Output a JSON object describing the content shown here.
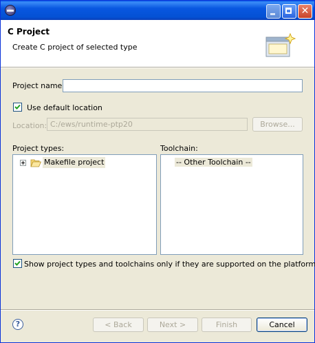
{
  "window": {
    "title": "",
    "controls": [
      "minimize-icon",
      "maximize-icon",
      "close-icon"
    ]
  },
  "header": {
    "title": "C Project",
    "description": "Create C project of selected type"
  },
  "form": {
    "project_name_label": "Project name:",
    "project_name_value": "",
    "use_default_location_label": "Use default location",
    "use_default_location_checked": true,
    "location_label": "Location:",
    "location_value": "C:/ews/runtime-ptp20",
    "browse_label": "Browse..."
  },
  "project_types": {
    "label": "Project types:",
    "items": [
      {
        "label": "Makefile project",
        "icon": "folder-open-icon",
        "expandable": true,
        "selected": true
      }
    ]
  },
  "toolchain": {
    "label": "Toolchain:",
    "items": [
      {
        "label": "-- Other Toolchain --",
        "selected": true
      }
    ]
  },
  "filter": {
    "label": "Show project types and toolchains only if they are supported on the platform",
    "checked": true
  },
  "buttons": {
    "back": "< Back",
    "next": "Next >",
    "finish": "Finish",
    "cancel": "Cancel"
  },
  "colors": {
    "titlebar": "#0857e0",
    "dialog_bg": "#ece9d8",
    "checkmark": "#21a121",
    "input_border": "#7f9db9"
  }
}
